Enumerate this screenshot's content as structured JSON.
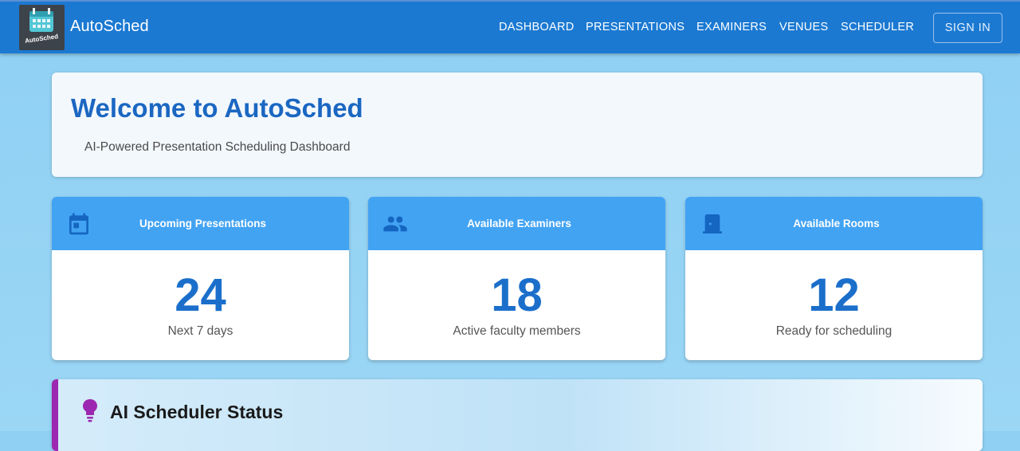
{
  "app": {
    "name": "AutoSched",
    "logo_text": "AutoSched"
  },
  "nav": {
    "items": [
      {
        "label": "DASHBOARD"
      },
      {
        "label": "PRESENTATIONS"
      },
      {
        "label": "EXAMINERS"
      },
      {
        "label": "VENUES"
      },
      {
        "label": "SCHEDULER"
      }
    ],
    "sign_in": "SIGN IN"
  },
  "welcome": {
    "title": "Welcome to AutoSched",
    "subtitle": "AI-Powered Presentation Scheduling Dashboard"
  },
  "cards": [
    {
      "title": "Upcoming Presentations",
      "value": "24",
      "sub": "Next 7 days",
      "icon": "calendar-icon"
    },
    {
      "title": "Available Examiners",
      "value": "18",
      "sub": "Active faculty members",
      "icon": "people-icon"
    },
    {
      "title": "Available Rooms",
      "value": "12",
      "sub": "Ready for scheduling",
      "icon": "door-icon"
    }
  ],
  "status": {
    "title": "AI Scheduler Status",
    "icon": "lightbulb-icon"
  },
  "colors": {
    "appbar": "#1b79d2",
    "card_header": "#42a3f3",
    "accent_value": "#1b6fcb",
    "status_accent": "#9c27b0"
  }
}
